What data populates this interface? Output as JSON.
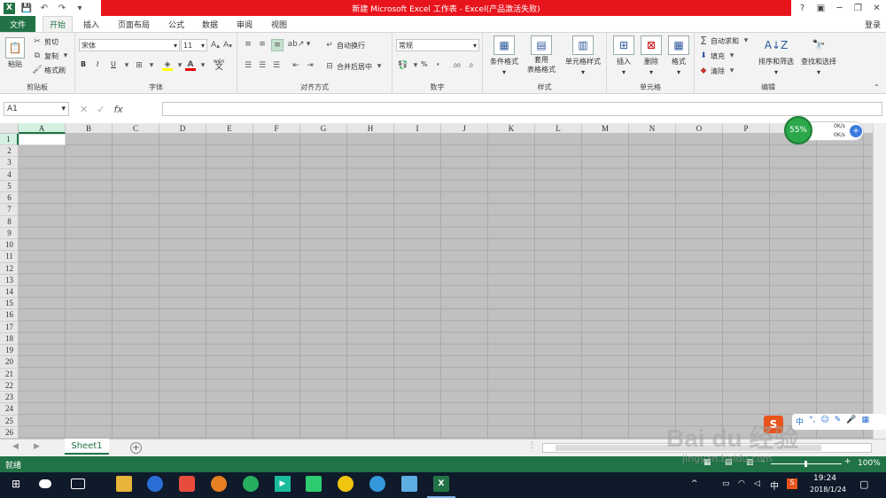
{
  "title_bar": {
    "document_title": "新建 Microsoft Excel 工作表 - Excel(产品激活失败)",
    "help": "?",
    "min": "─",
    "restore": "❐",
    "close": "✕"
  },
  "tabs": {
    "file": "文件",
    "items": [
      "开始",
      "插入",
      "页面布局",
      "公式",
      "数据",
      "审阅",
      "视图"
    ],
    "login": "登录"
  },
  "clipboard": {
    "paste": "粘贴",
    "cut": "剪切",
    "copy": "复制",
    "format_painter": "格式刷",
    "label": "剪贴板"
  },
  "font": {
    "name": "宋体",
    "size": "11",
    "bold": "B",
    "italic": "I",
    "underline": "U",
    "label": "字体",
    "font_color_letter": "A",
    "wen": "wén"
  },
  "alignment": {
    "wrap": "自动换行",
    "merge": "合并后居中",
    "label": "对齐方式"
  },
  "number": {
    "format": "常规",
    "percent": "%",
    "comma": ",",
    "label": "数字"
  },
  "styles": {
    "conditional": "条件格式",
    "table_line1": "套用",
    "table_line2": "表格格式",
    "cell_styles": "单元格样式",
    "label": "样式"
  },
  "cells": {
    "insert": "插入",
    "delete": "删除",
    "format": "格式",
    "label": "单元格"
  },
  "editing": {
    "autosum": "自动求和",
    "fill": "填充",
    "clear": "清除",
    "sort": "排序和筛选",
    "find": "查找和选择",
    "label": "编辑"
  },
  "formula_bar": {
    "name_box": "A1",
    "fx": "fx",
    "value": ""
  },
  "columns": [
    "A",
    "B",
    "C",
    "D",
    "E",
    "F",
    "G",
    "H",
    "I",
    "J",
    "K",
    "L",
    "M",
    "N",
    "O",
    "P"
  ],
  "rows": [
    "1",
    "2",
    "3",
    "4",
    "5",
    "6",
    "7",
    "8",
    "9",
    "10",
    "11",
    "12",
    "13",
    "14",
    "15",
    "16",
    "17",
    "18",
    "19",
    "20",
    "21",
    "22",
    "23",
    "24",
    "25",
    "26"
  ],
  "sheet": {
    "tab": "Sheet1",
    "add": "+"
  },
  "status": {
    "ready": "就绪",
    "zoom": "100%",
    "minus": "-",
    "plus": "+"
  },
  "net_widget": {
    "percent": "55%",
    "up": "0K/s",
    "down": "0K/s"
  },
  "watermark": {
    "brand": "Bai du 经验",
    "url": "jingyan.baidu.com"
  },
  "taskbar": {
    "time": "19:24",
    "date": "2018/1/24",
    "ime": "中"
  }
}
